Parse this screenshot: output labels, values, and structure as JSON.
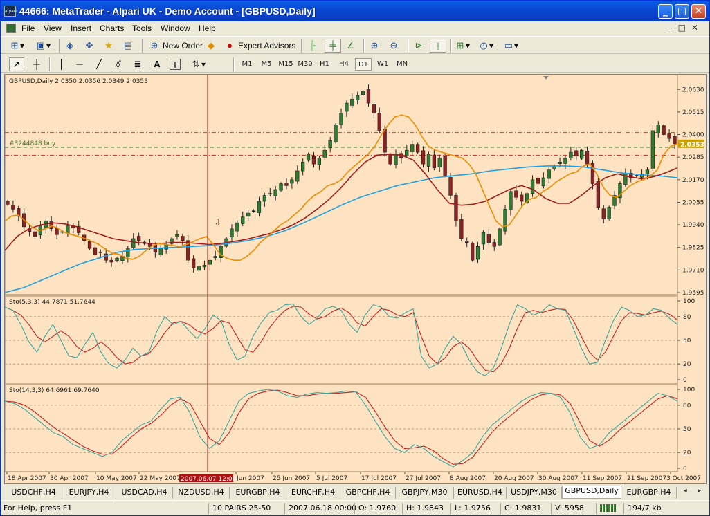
{
  "window": {
    "title": "44666: MetaTrader - Alpari UK - Demo Account - [GBPUSD,Daily]",
    "icon_text": "alpari"
  },
  "menu": [
    "File",
    "View",
    "Insert",
    "Charts",
    "Tools",
    "Window",
    "Help"
  ],
  "toolbar": {
    "new_order": "New Order",
    "expert_advisors": "Expert Advisors"
  },
  "timeframes": {
    "items": [
      "M1",
      "M5",
      "M15",
      "M30",
      "H1",
      "H4",
      "D1",
      "W1",
      "MN"
    ],
    "active": "D1"
  },
  "chart": {
    "main_label": "GBPUSD,Daily  2.0350 2.0356 2.0349 2.0353",
    "order_label": "#3244848 buy",
    "current_price": "2.0353",
    "stoch1_label": "Sto(5,3,3) 44.7871 51.7644",
    "stoch2_label": "Sto(14,3,3) 64.6961 69.7640",
    "crosshair_label": "2007.06.07 12:00",
    "price_ticks": [
      "2.0630",
      "2.0515",
      "2.0400",
      "2.0285",
      "2.0170",
      "2.0055",
      "1.9940",
      "1.9825",
      "1.9710",
      "1.9595"
    ],
    "stoch_ticks": [
      "100",
      "80",
      "50",
      "20",
      "0"
    ],
    "date_labels": [
      "18 Apr 2007",
      "30 Apr 2007",
      "10 May 2007",
      "22 May 2007",
      "Jun 2007",
      "25 Jun 2007",
      "5 Jul 2007",
      "17 Jul 2007",
      "27 Jul 2007",
      "8 Aug 2007",
      "20 Aug 2007",
      "30 Aug 2007",
      "11 Sep 2007",
      "21 Sep 2007",
      "3 Oct 2007"
    ],
    "colors": {
      "background": "#fde3c1",
      "up_candle": "#2e7d32",
      "down_candle": "#8b2323",
      "ma_fast": "#f08c00",
      "ma_mid": "#a31b1b",
      "ma_slow": "#1ea0e6",
      "stoch_main": "#3aa6a0",
      "stoch_signal": "#c81e1e"
    }
  },
  "tabs": {
    "items": [
      "USDCHF,H4",
      "EURJPY,H4",
      "USDCAD,H4",
      "NZDUSD,H4",
      "EURGBP,H4",
      "EURCHF,H4",
      "GBPCHF,H4",
      "GBPJPY,M30",
      "EURUSD,H4",
      "USDJPY,M30",
      "GBPUSD,Daily",
      "EURGBP,H4"
    ],
    "active": "GBPUSD,Daily"
  },
  "status": {
    "help": "For Help, press F1",
    "profile": "10 PAIRS 25-50",
    "datetime": "2007.06.18 00:00",
    "open": "O: 1.9760",
    "high": "H: 1.9843",
    "low": "L: 1.9756",
    "close": "C: 1.9831",
    "volume": "V: 5958",
    "traffic": "194/7 kb"
  },
  "chart_data": {
    "type": "candlestick",
    "symbol": "GBPUSD",
    "period": "Daily",
    "ylim": [
      1.9595,
      2.0645
    ],
    "last_ohlc": {
      "open": 2.035,
      "high": 2.0356,
      "low": 2.0349,
      "close": 2.0353
    },
    "closes": [
      2.0045,
      2.002,
      1.9985,
      1.993,
      1.9905,
      1.988,
      1.9935,
      1.996,
      1.992,
      1.989,
      1.9905,
      1.9935,
      1.9925,
      1.99,
      1.986,
      1.982,
      1.979,
      1.98,
      1.976,
      1.975,
      1.977,
      1.978,
      1.982,
      1.987,
      1.986,
      1.9845,
      1.983,
      1.98,
      1.982,
      1.984,
      1.987,
      1.989,
      1.986,
      1.976,
      1.972,
      1.973,
      1.9735,
      1.976,
      1.978,
      1.9831,
      1.987,
      1.992,
      1.995,
      1.998,
      2.0,
      2.001,
      2.006,
      2.009,
      2.01,
      2.012,
      2.015,
      2.014,
      2.017,
      2.0215,
      2.026,
      2.03,
      2.025,
      2.028,
      2.032,
      2.037,
      2.045,
      2.051,
      2.056,
      2.058,
      2.06,
      2.062,
      2.056,
      2.051,
      2.042,
      2.031,
      2.025,
      2.03,
      2.028,
      2.032,
      2.035,
      2.031,
      2.025,
      2.03,
      2.023,
      2.028,
      2.019,
      2.009,
      1.996,
      1.987,
      1.985,
      1.976,
      1.983,
      1.99,
      1.985,
      1.983,
      1.992,
      2.002,
      2.011,
      2.008,
      2.006,
      2.01,
      2.017,
      2.015,
      2.018,
      2.022,
      2.024,
      2.026,
      2.028,
      2.031,
      2.029,
      2.032,
      2.025,
      2.015,
      2.003,
      1.997,
      2.003,
      2.009,
      2.015,
      2.02,
      2.018,
      2.019,
      2.02,
      2.022,
      2.042,
      2.045,
      2.04,
      2.038,
      2.0353
    ],
    "ma_fast": [
      1.996,
      1.9985,
      1.999,
      1.996,
      1.993,
      1.991,
      1.992,
      1.9935,
      1.992,
      1.99,
      1.989,
      1.988,
      1.987,
      1.9855,
      1.984,
      1.9815,
      1.9795,
      1.979,
      1.977,
      1.9765,
      1.978,
      1.981,
      1.9835,
      1.9845,
      1.984,
      1.9835,
      1.983,
      1.984,
      1.9855,
      1.987,
      1.988,
      1.984,
      1.979,
      1.977,
      1.976,
      1.976,
      1.978,
      1.981,
      1.985,
      1.988,
      1.991,
      1.994,
      1.996,
      1.999,
      2.002,
      2.006,
      2.009,
      2.011,
      2.014,
      2.015,
      2.017,
      2.021,
      2.024,
      2.027,
      2.03,
      2.034,
      2.04,
      2.045,
      2.049,
      2.05,
      2.049,
      2.045,
      2.039,
      2.034,
      2.032,
      2.031,
      2.03,
      2.029,
      2.028,
      2.025,
      2.02,
      2.012,
      2.004,
      1.996,
      1.993,
      1.994,
      1.999,
      2.004,
      2.007,
      2.008,
      2.011,
      2.013,
      2.016,
      2.018,
      2.02,
      2.021,
      2.024,
      2.025,
      2.02,
      2.013,
      2.009,
      2.008,
      2.011,
      2.014,
      2.016,
      2.017,
      2.019,
      2.022,
      2.03,
      2.034,
      2.0353
    ],
    "ma_mid": [
      1.981,
      1.988,
      1.992,
      1.994,
      1.995,
      1.9945,
      1.993,
      1.991,
      1.989,
      1.987,
      1.986,
      1.985,
      1.9845,
      1.9845,
      1.985,
      1.985,
      1.9845,
      1.984,
      1.9845,
      1.9855,
      1.9865,
      1.988,
      1.9895,
      1.9915,
      1.994,
      1.9975,
      2.002,
      2.007,
      2.013,
      2.02,
      2.026,
      2.0295,
      2.03,
      2.0295,
      2.027,
      2.02,
      2.012,
      2.005,
      2.004,
      2.0045,
      2.006,
      2.009,
      2.012,
      2.014,
      2.012,
      2.0075,
      2.005,
      2.005,
      2.009,
      2.014,
      2.018,
      2.02,
      2.0185,
      2.0175,
      2.0185,
      2.0205,
      2.023
    ],
    "ma_slow": [
      1.9595,
      1.962,
      1.966,
      1.97,
      1.974,
      1.977,
      1.98,
      1.9815,
      1.982,
      1.9825,
      1.983,
      1.9835,
      1.9845,
      1.986,
      1.988,
      1.991,
      1.995,
      1.9995,
      2.004,
      2.008,
      2.011,
      2.014,
      2.016,
      2.018,
      2.019,
      2.02,
      2.0215,
      2.0225,
      2.0235,
      2.024,
      2.024,
      2.0235,
      2.022,
      2.0205,
      2.0195,
      2.019,
      2.018
    ],
    "order_level": 2.0335,
    "red_levels": [
      2.041,
      2.0295
    ],
    "stoch_fast": [
      92,
      88,
      70,
      48,
      35,
      55,
      70,
      50,
      30,
      28,
      45,
      60,
      35,
      20,
      15,
      25,
      40,
      30,
      35,
      62,
      80,
      70,
      74,
      62,
      52,
      65,
      82,
      75,
      45,
      25,
      30,
      55,
      72,
      85,
      88,
      95,
      96,
      80,
      70,
      78,
      90,
      93,
      88,
      70,
      60,
      82,
      95,
      92,
      80,
      78,
      85,
      90,
      30,
      15,
      20,
      40,
      55,
      45,
      25,
      10,
      5,
      15,
      40,
      70,
      95,
      90,
      82,
      86,
      95,
      90,
      88,
      65,
      40,
      20,
      22,
      50,
      75,
      92,
      88,
      80,
      82,
      90,
      88,
      78,
      70
    ],
    "stoch_slow": [
      92,
      88,
      82,
      70,
      55,
      48,
      55,
      62,
      55,
      42,
      35,
      40,
      48,
      40,
      28,
      20,
      22,
      30,
      33,
      45,
      60,
      72,
      74,
      70,
      62,
      58,
      65,
      75,
      72,
      55,
      38,
      35,
      48,
      65,
      78,
      88,
      93,
      92,
      83,
      77,
      80,
      87,
      91,
      85,
      72,
      68,
      80,
      90,
      88,
      82,
      80,
      85,
      55,
      30,
      20,
      28,
      42,
      48,
      40,
      25,
      12,
      10,
      20,
      40,
      65,
      85,
      88,
      85,
      88,
      90,
      89,
      75,
      55,
      35,
      25,
      35,
      55,
      75,
      85,
      84,
      82,
      85,
      87,
      83,
      76
    ],
    "stoch2_fast": [
      85,
      82,
      75,
      65,
      55,
      45,
      40,
      30,
      25,
      20,
      15,
      20,
      35,
      45,
      55,
      60,
      75,
      88,
      90,
      70,
      40,
      25,
      35,
      60,
      85,
      95,
      98,
      100,
      98,
      92,
      90,
      94,
      96,
      95,
      96,
      98,
      97,
      80,
      60,
      40,
      25,
      20,
      30,
      25,
      15,
      8,
      2,
      10,
      20,
      40,
      55,
      65,
      75,
      85,
      92,
      96,
      95,
      90,
      70,
      40,
      25,
      30,
      45,
      55,
      65,
      75,
      85,
      95,
      92,
      85
    ],
    "stoch2_slow": [
      85,
      84,
      80,
      72,
      62,
      52,
      44,
      36,
      28,
      22,
      18,
      18,
      28,
      40,
      50,
      57,
      67,
      80,
      88,
      82,
      60,
      38,
      30,
      45,
      70,
      88,
      95,
      98,
      99,
      96,
      92,
      92,
      94,
      95,
      95,
      96,
      97,
      90,
      72,
      52,
      35,
      25,
      26,
      28,
      22,
      12,
      5,
      6,
      14,
      30,
      46,
      58,
      68,
      78,
      87,
      93,
      95,
      93,
      82,
      58,
      35,
      28,
      36,
      48,
      58,
      68,
      78,
      88,
      92,
      88
    ]
  }
}
